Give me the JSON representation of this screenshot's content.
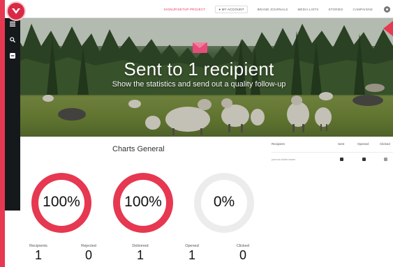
{
  "nav": {
    "items": [
      {
        "label": "SIGNUP/SETUP PROJECT",
        "accent": true
      },
      {
        "label": "MY ACCOUNT",
        "account": true
      },
      {
        "label": "BRAND JOURNALS"
      },
      {
        "label": "MEDIA LISTS"
      },
      {
        "label": "STORIES"
      },
      {
        "label": "CAMPAIGNS"
      }
    ]
  },
  "sidebar": {
    "icons": [
      "menu-icon",
      "search-icon",
      "minus-icon"
    ]
  },
  "hero": {
    "title": "Sent to 1 recipient",
    "subtitle": "Show the statistics and send out a quality follow-up"
  },
  "charts": {
    "title": "Charts General",
    "circles": [
      {
        "label": "100%",
        "value": 100,
        "color": "#e63850"
      },
      {
        "label": "100%",
        "value": 100,
        "color": "#e63850"
      },
      {
        "label": "0%",
        "value": 0,
        "color": "#e63850"
      }
    ]
  },
  "stats": [
    {
      "label": "Recipients",
      "value": "1"
    },
    {
      "label": "Rejected",
      "value": "0"
    },
    {
      "label": "Delivered",
      "value": "1"
    },
    {
      "label": "Opened",
      "value": "1"
    },
    {
      "label": "Clicked",
      "value": "0"
    }
  ],
  "table": {
    "headers": {
      "recipient": "Recipient",
      "sent": "Sent",
      "opened": "Opened",
      "clicked": "Clicked"
    },
    "rows": [
      {
        "recipient": "joanna.wildemaster"
      }
    ]
  },
  "colors": {
    "accent": "#e63850",
    "sidebar": "#16191c",
    "ring_empty": "#ececec"
  }
}
